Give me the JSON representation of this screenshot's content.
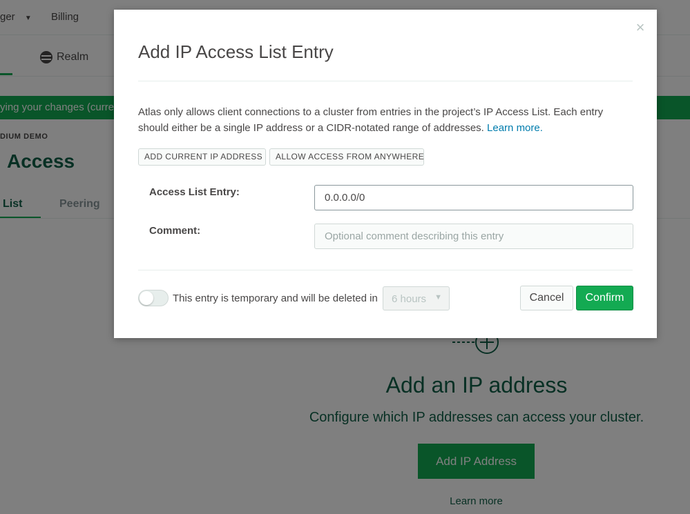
{
  "background": {
    "topnav": {
      "access_manager_fragment": "ger",
      "caret": "▼",
      "billing": "Billing"
    },
    "subnav": {
      "realm": "Realm"
    },
    "banner_text": "ying your changes (curre",
    "project_label": "DIUM DEMO",
    "page_title": "Access",
    "tabs": [
      "List",
      "Peering"
    ],
    "empty_state": {
      "title": "Add an IP address",
      "subtitle": "Configure which IP addresses can access your cluster.",
      "button": "Add IP Address",
      "link": "Learn more"
    }
  },
  "modal": {
    "title": "Add IP Access List Entry",
    "close": "×",
    "description": "Atlas only allows client connections to a cluster from entries in the project’s IP Access List. Each entry should either be a single IP address or a CIDR-notated range of addresses.",
    "learn_more": "Learn more.",
    "quick_buttons": {
      "add_current": "ADD CURRENT IP ADDRESS",
      "allow_anywhere": "ALLOW ACCESS FROM ANYWHERE"
    },
    "fields": {
      "entry_label": "Access List Entry:",
      "entry_value": "0.0.0.0/0",
      "comment_label": "Comment:",
      "comment_placeholder": "Optional comment describing this entry"
    },
    "temporary": {
      "text": "This entry is temporary and will be deleted in",
      "duration": "6 hours",
      "caret": "▼",
      "enabled": false
    },
    "actions": {
      "cancel": "Cancel",
      "confirm": "Confirm"
    }
  },
  "colors": {
    "brand_green": "#13aa52",
    "dark_green": "#116149",
    "link_blue": "#007cad",
    "text_gray": "#494747"
  }
}
